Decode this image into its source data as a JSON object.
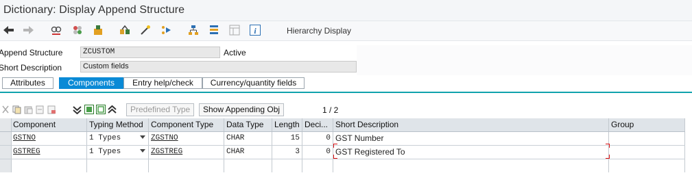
{
  "window": {
    "title": "Dictionary: Display Append Structure"
  },
  "toolbar": {
    "hierarchy_display": "Hierarchy Display",
    "icons": [
      "back-arrow-icon",
      "forward-arrow-icon",
      "display-change-icon",
      "other-object-icon",
      "activate-icon",
      "where-used-icon",
      "magic-wand-icon",
      "navigation-icon",
      "hierarchy-icon",
      "stack-icon",
      "layout-icon",
      "info-icon"
    ]
  },
  "header": {
    "append_structure_label": "Append Structure",
    "append_structure_value": "ZCUSTOM",
    "status": "Active",
    "short_description_label": "Short Description",
    "short_description_value": "Custom fields"
  },
  "tabs": [
    {
      "label": "Attributes",
      "active": false
    },
    {
      "label": "Components",
      "active": true
    },
    {
      "label": "Entry help/check",
      "active": false
    },
    {
      "label": "Currency/quantity fields",
      "active": false
    }
  ],
  "table_toolbar": {
    "predefined_type": "Predefined Type",
    "show_appending": "Show Appending Obj",
    "pager": "1 / 2"
  },
  "table": {
    "columns": [
      "Component",
      "Typing Method",
      "Component Type",
      "Data Type",
      "Length",
      "Deci...",
      "Short Description",
      "Group"
    ],
    "rows": [
      [
        "GSTNO",
        "1 Types",
        "ZGSTNO",
        "CHAR",
        "15",
        "0",
        "GST Number",
        ""
      ],
      [
        "GSTREG",
        "1 Types",
        "ZGSTREG",
        "CHAR",
        "3",
        "0",
        "GST Registered To",
        ""
      ],
      [
        "",
        "",
        "",
        "",
        "",
        "",
        "",
        ""
      ]
    ]
  },
  "colors": {
    "active_tab": "#0a8ad6",
    "tab_underline": "#0fa3ad",
    "header_bg": "#dfe4e9"
  }
}
